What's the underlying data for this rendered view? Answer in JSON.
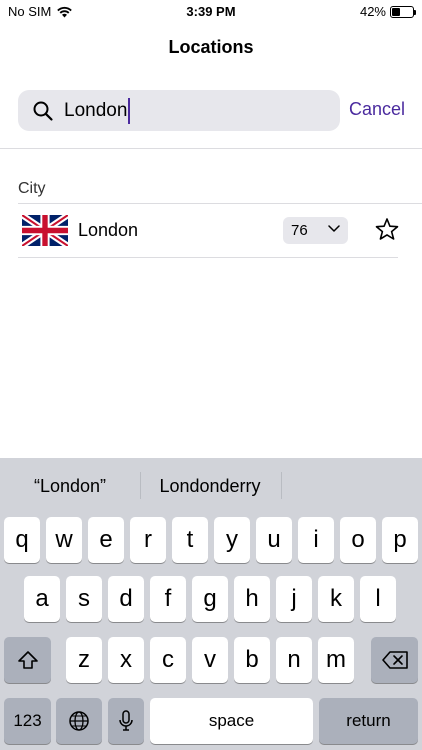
{
  "status_bar": {
    "carrier": "No SIM",
    "time": "3:39 PM",
    "battery_percent": "42%",
    "battery_level": 0.42
  },
  "nav": {
    "title": "Locations"
  },
  "search": {
    "value": "London",
    "cancel_label": "Cancel"
  },
  "results": {
    "section_title": "City",
    "items": [
      {
        "name": "London",
        "aqi_value": "76",
        "flag": "uk-flag",
        "favorite": false
      }
    ]
  },
  "keyboard": {
    "suggestions": [
      "“London”",
      "Londonderry"
    ],
    "row1": [
      "q",
      "w",
      "e",
      "r",
      "t",
      "y",
      "u",
      "i",
      "o",
      "p"
    ],
    "row2": [
      "a",
      "s",
      "d",
      "f",
      "g",
      "h",
      "j",
      "k",
      "l"
    ],
    "row3": [
      "z",
      "x",
      "c",
      "v",
      "b",
      "n",
      "m"
    ],
    "numbers_label": "123",
    "space_label": "space",
    "return_label": "return"
  },
  "colors": {
    "accent": "#4a2a9e",
    "field_background": "#e7e7ec",
    "keyboard_background": "#d1d3d9"
  }
}
